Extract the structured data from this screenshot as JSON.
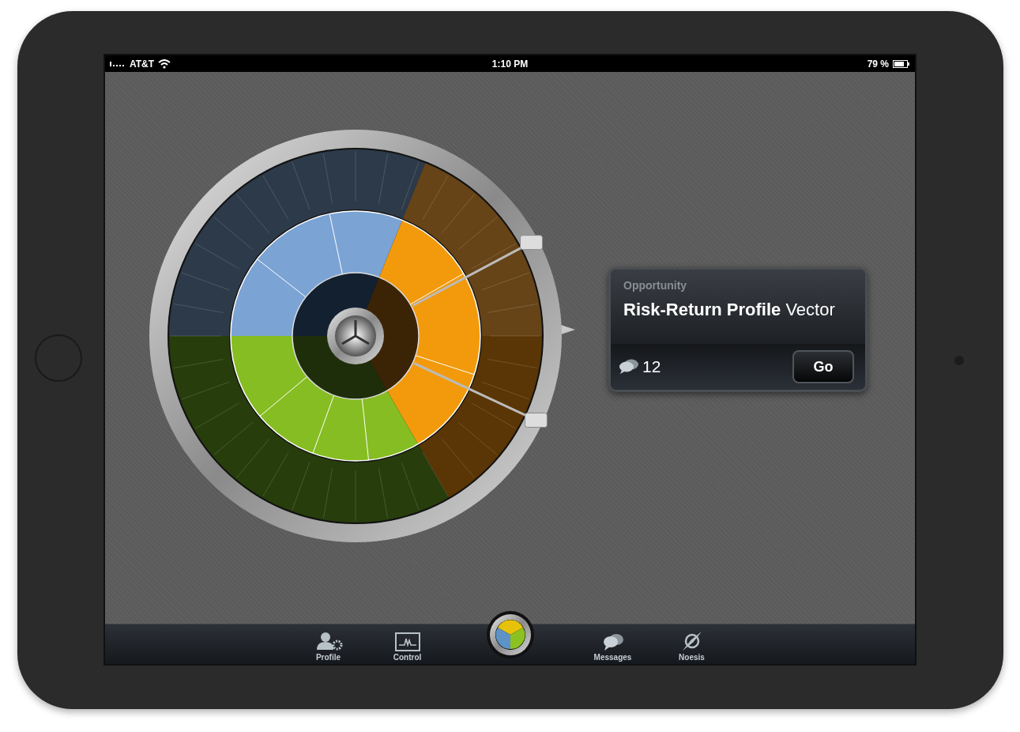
{
  "status_bar": {
    "carrier": "AT&T",
    "time": "1:10 PM",
    "battery": "79 %"
  },
  "callout": {
    "label": "Opportunity",
    "title": "**Risk-Return Profile** Vector",
    "comments": "12",
    "button": "Go"
  },
  "tabs": [
    {
      "kind": "profile",
      "label": "Profile"
    },
    {
      "kind": "control",
      "label": "Control"
    },
    {
      "kind": "messages",
      "label": "Messages"
    },
    {
      "kind": "noesis",
      "label": "Noesis"
    }
  ]
}
